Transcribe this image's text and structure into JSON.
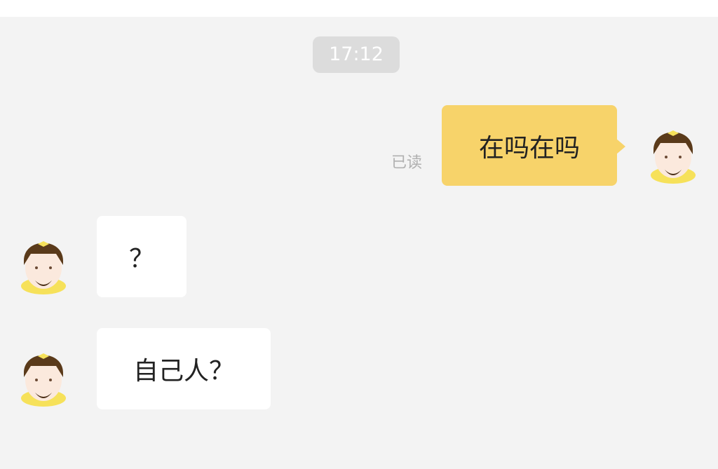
{
  "conversation": {
    "timestamp": "17:12",
    "messages": [
      {
        "direction": "sent",
        "text": "在吗在吗",
        "status": "已读"
      },
      {
        "direction": "received",
        "text": "？"
      },
      {
        "direction": "received",
        "text": "自己人？"
      }
    ]
  },
  "colors": {
    "background": "#f3f3f3",
    "sent_bubble": "#f7d36a",
    "received_bubble": "#ffffff",
    "timestamp_badge": "#dcdcdc",
    "read_receipt": "#b0b0b0",
    "avatar_helmet": "#5a3a1a",
    "avatar_collar": "#f6e15a"
  },
  "icons": {
    "avatar": "delivery-rider-avatar-icon"
  }
}
